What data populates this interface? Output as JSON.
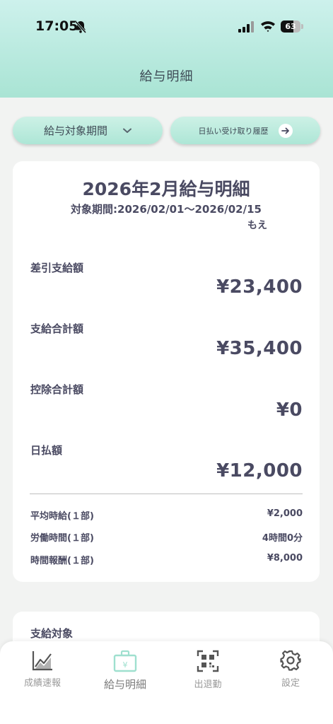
{
  "status_bar": {
    "time": "17:05",
    "battery": "63",
    "battery_level": 0.63
  },
  "header": {
    "title": "給与明細"
  },
  "filters": {
    "period_label": "給与対象期間",
    "history_label": "日払い受け取り履歴"
  },
  "payslip": {
    "title": "2026年2月給与明細",
    "period": "対象期間:2026/02/01〜2026/02/15",
    "name": "もえ",
    "amounts": [
      {
        "label": "差引支給額",
        "value": "¥23,400"
      },
      {
        "label": "支給合計額",
        "value": "¥35,400"
      },
      {
        "label": "控除合計額",
        "value": "¥0"
      },
      {
        "label": "日払額",
        "value": "¥12,000"
      }
    ],
    "details": [
      {
        "label": "平均時給(１部)",
        "value": "¥2,000"
      },
      {
        "label": "労働時間(１部)",
        "value": "4時間0分"
      },
      {
        "label": "時間報酬(１部)",
        "value": "¥8,000"
      }
    ]
  },
  "payment_section": {
    "title": "支給対象"
  },
  "tabs": [
    {
      "label": "成績速報",
      "icon": "chart-icon"
    },
    {
      "label": "給与明細",
      "icon": "payslip-icon",
      "active": true
    },
    {
      "label": "出退勤",
      "icon": "qr-code-icon"
    },
    {
      "label": "設定",
      "icon": "gear-icon"
    }
  ],
  "colors": {
    "header_gradient_top": "#cdf1ec",
    "header_gradient_bottom": "#a9e4d4",
    "accent_mint": "#9fe0cf",
    "text_primary": "#4a4a62",
    "background": "#f2f3f2"
  }
}
